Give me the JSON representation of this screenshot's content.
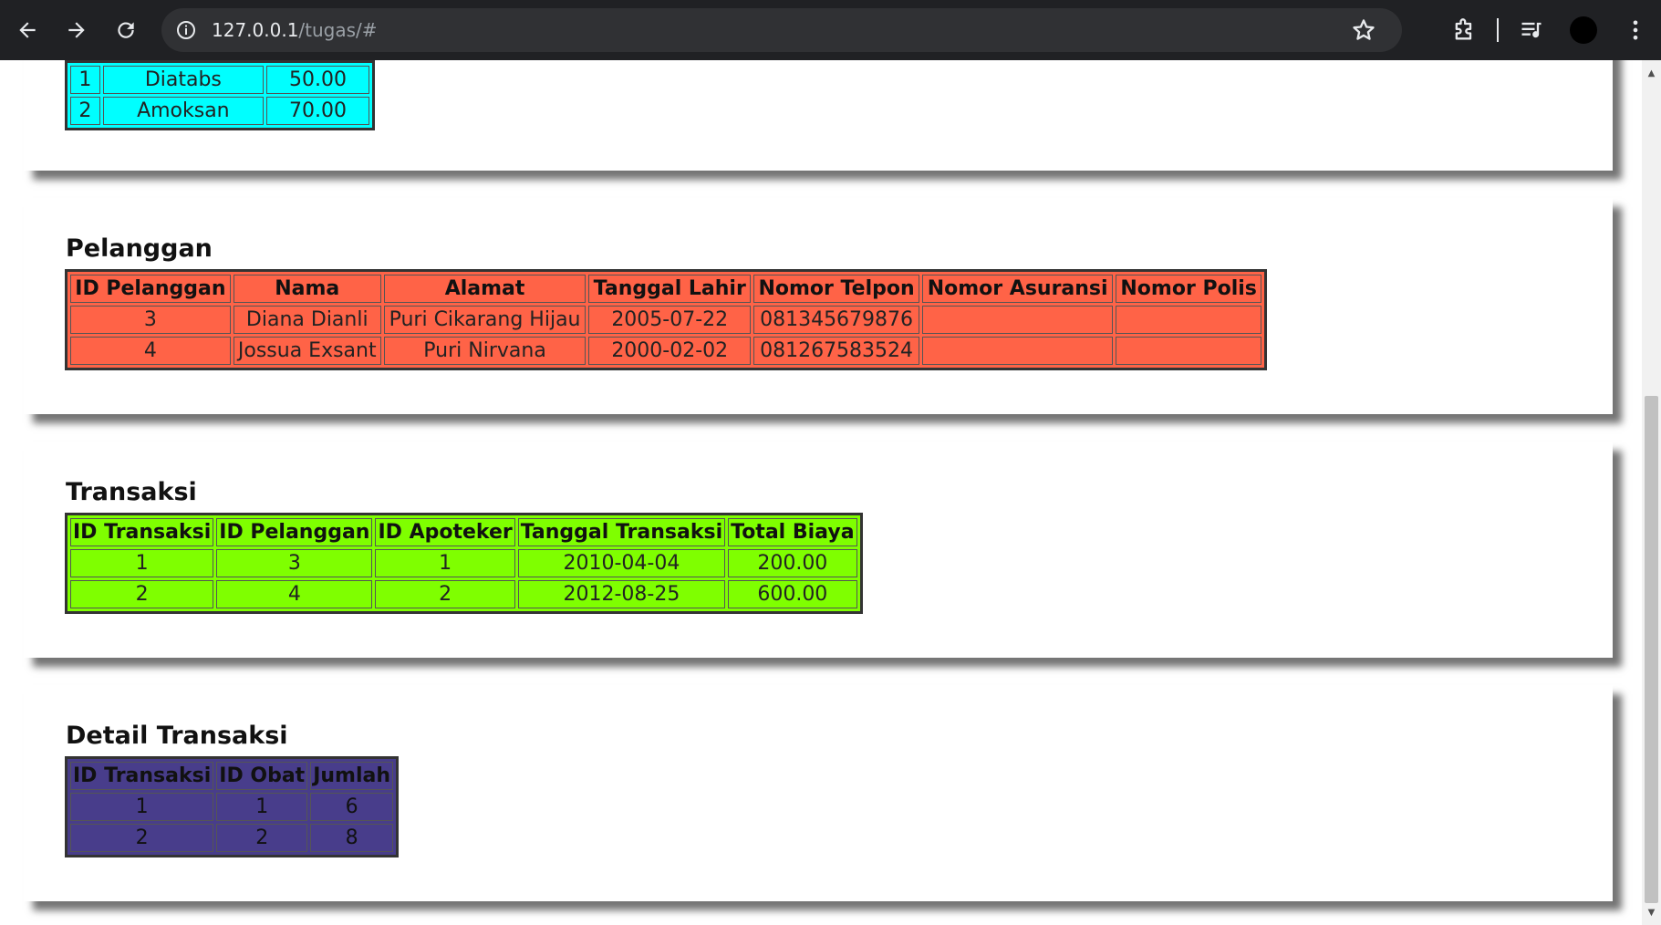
{
  "browser": {
    "url_host": "127.0.0.1",
    "url_path": "/tugas/#"
  },
  "obat_partial": {
    "rows": [
      [
        "1",
        "Diatabs",
        "50.00"
      ],
      [
        "2",
        "Amoksan",
        "70.00"
      ]
    ]
  },
  "pelanggan": {
    "title": "Pelanggan",
    "headers": [
      "ID Pelanggan",
      "Nama",
      "Alamat",
      "Tanggal Lahir",
      "Nomor Telpon",
      "Nomor Asuransi",
      "Nomor Polis"
    ],
    "rows": [
      [
        "3",
        "Diana Dianli",
        "Puri Cikarang Hijau",
        "2005-07-22",
        "081345679876",
        "",
        ""
      ],
      [
        "4",
        "Jossua Exsant",
        "Puri Nirvana",
        "2000-02-02",
        "081267583524",
        "",
        ""
      ]
    ]
  },
  "transaksi": {
    "title": "Transaksi",
    "headers": [
      "ID Transaksi",
      "ID Pelanggan",
      "ID Apoteker",
      "Tanggal Transaksi",
      "Total Biaya"
    ],
    "rows": [
      [
        "1",
        "3",
        "1",
        "2010-04-04",
        "200.00"
      ],
      [
        "2",
        "4",
        "2",
        "2012-08-25",
        "600.00"
      ]
    ]
  },
  "detail_transaksi": {
    "title": "Detail Transaksi",
    "headers": [
      "ID Transaksi",
      "ID Obat",
      "Jumlah"
    ],
    "rows": [
      [
        "1",
        "1",
        "6"
      ],
      [
        "2",
        "2",
        "8"
      ]
    ]
  },
  "colors": {
    "obat": "#00ffff",
    "pelanggan": "#ff6347",
    "transaksi": "#7fff00",
    "detail_transaksi": "#483d8b"
  },
  "icons": {
    "back": "arrow-left-icon",
    "forward": "arrow-right-icon",
    "reload": "reload-icon",
    "site_info": "info-icon",
    "bookmark": "star-icon",
    "extensions": "puzzle-icon",
    "media": "playlist-icon",
    "menu": "more-vert-icon"
  }
}
